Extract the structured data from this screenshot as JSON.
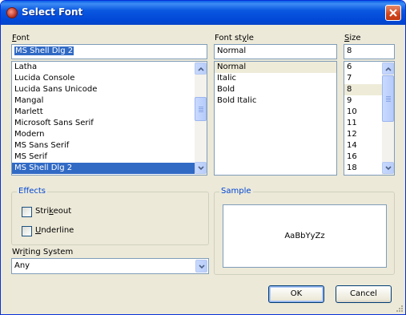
{
  "window": {
    "title": "Select Font",
    "icon": "app-icon",
    "close_icon": "close-icon"
  },
  "font": {
    "label_first": "F",
    "label_rest": "ont",
    "value": "MS Shell Dlg 2",
    "items": [
      "Latha",
      "Lucida Console",
      "Lucida Sans Unicode",
      "Mangal",
      "Marlett",
      "Microsoft Sans Serif",
      "Modern",
      "MS Sans Serif",
      "MS Serif",
      "MS Shell Dlg 2"
    ],
    "selected_index": 9
  },
  "style": {
    "label_first": "Font st",
    "label_ul": "y",
    "label_rest": "le",
    "value": "Normal",
    "items": [
      "Normal",
      "Italic",
      "Bold",
      "Bold Italic"
    ],
    "selected_index": 0
  },
  "size": {
    "label_first": "",
    "label_ul": "S",
    "label_rest": "ize",
    "value": "8",
    "items": [
      "6",
      "7",
      "8",
      "9",
      "10",
      "11",
      "12",
      "14",
      "16",
      "18"
    ],
    "selected_index": 2
  },
  "effects": {
    "title": "Effects",
    "strikeout": {
      "pre": "Stri",
      "ul": "k",
      "post": "eout",
      "checked": false
    },
    "underline": {
      "pre": "",
      "ul": "U",
      "post": "nderline",
      "checked": false
    }
  },
  "sample": {
    "title": "Sample",
    "text": "AaBbYyZz"
  },
  "writing_system": {
    "label_pre": "Wr",
    "label_ul": "i",
    "label_post": "ting System",
    "value": "Any"
  },
  "buttons": {
    "ok": "OK",
    "cancel": "Cancel"
  },
  "colors": {
    "title_bar": "#0046d5",
    "selection": "#316ac5",
    "group_title": "#0046d5",
    "face": "#ece9d8"
  }
}
